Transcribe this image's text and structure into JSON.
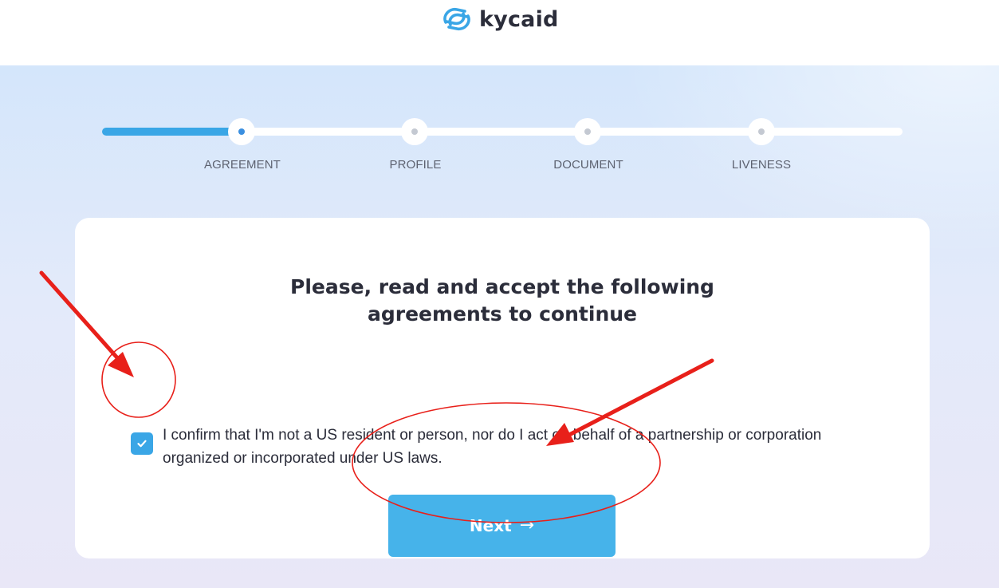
{
  "header": {
    "brand": "kycaid",
    "brand_color": "#3aa6e6"
  },
  "stepper": {
    "progress": 0.186,
    "steps": [
      {
        "label": "AGREEMENT",
        "state": "active"
      },
      {
        "label": "PROFILE",
        "state": "pending"
      },
      {
        "label": "DOCUMENT",
        "state": "pending"
      },
      {
        "label": "LIVENESS",
        "state": "pending"
      }
    ],
    "active_color": "#3aa6e6"
  },
  "card": {
    "title_line1": "Please, read and accept the following",
    "title_line2": "agreements to continue",
    "agreement": {
      "checked": true,
      "text": "I confirm that I'm not a US resident or person, nor do I act on behalf of a partnership or corporation organized or incorporated under US laws."
    },
    "next_button": {
      "label": "Next",
      "icon": "arrow-right-icon",
      "color": "#46b3ea"
    }
  },
  "annotations": {
    "color": "#e8201a",
    "items": [
      "arrow-to-checkbox",
      "circle-around-checkbox",
      "arrow-to-next-button",
      "ellipse-around-next-button"
    ]
  }
}
